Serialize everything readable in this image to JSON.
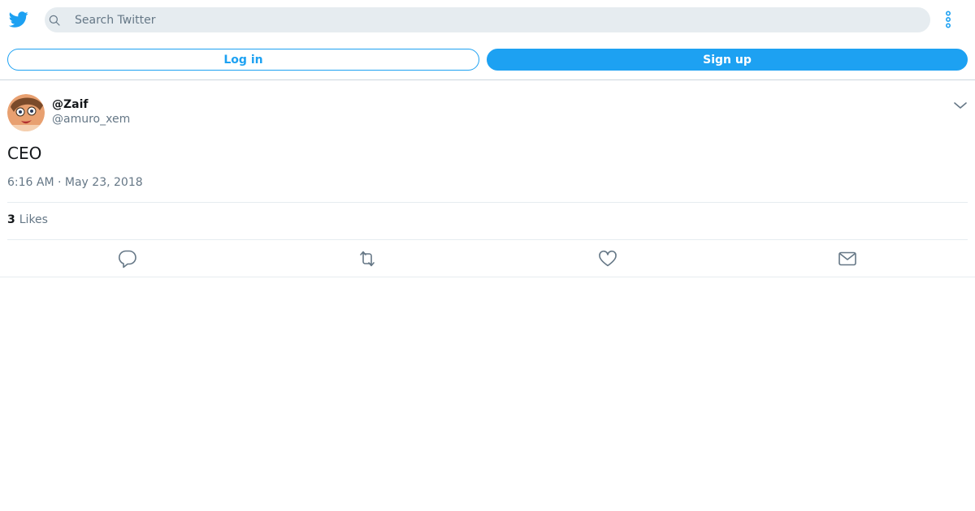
{
  "colors": {
    "accent": "#1da1f2",
    "muted": "#657786",
    "text": "#14171a",
    "search_bg": "#e6ecf0"
  },
  "header": {
    "logo_icon": "twitter-bird-icon",
    "search": {
      "placeholder": "Search Twitter",
      "value": ""
    },
    "more_icon": "more-vertical-icon"
  },
  "auth": {
    "login_label": "Log in",
    "signup_label": "Sign up"
  },
  "tweet": {
    "display_name": "@Zaif",
    "handle": "@amuro_xem",
    "text": "CEO",
    "timestamp": "6:16 AM · May 23, 2018",
    "likes_count": "3",
    "likes_label": "Likes",
    "actions": [
      "reply-icon",
      "retweet-icon",
      "like-icon",
      "share-icon"
    ]
  }
}
